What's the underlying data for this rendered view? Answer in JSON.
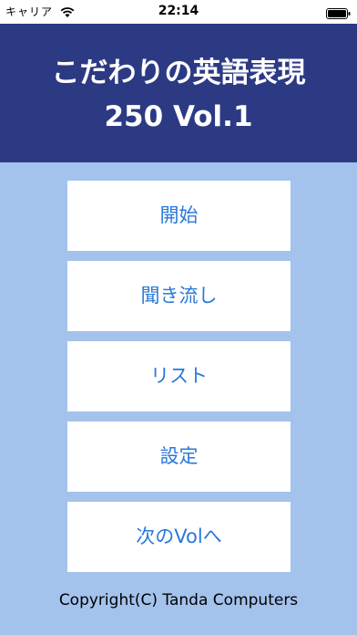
{
  "status_bar": {
    "carrier": "キャリア",
    "wifi_icon": "wifi-icon",
    "time": "22:14",
    "battery_icon": "battery-icon"
  },
  "header": {
    "title_line1": "こだわりの英語表現",
    "title_line2": "250 Vol.1"
  },
  "menu": {
    "items": [
      {
        "label": "開始"
      },
      {
        "label": "聞き流し"
      },
      {
        "label": "リスト"
      },
      {
        "label": "設定"
      },
      {
        "label": "次のVolへ"
      }
    ]
  },
  "footer": {
    "copyright": "Copyright(C) Tanda Computers"
  },
  "colors": {
    "background": "#a3c2ec",
    "header": "#2c3a84",
    "button_text": "#2979d8"
  }
}
